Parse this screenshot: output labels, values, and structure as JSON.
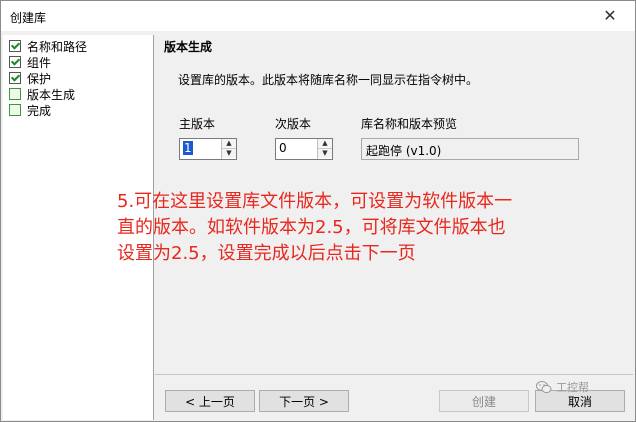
{
  "window": {
    "title": "创建库",
    "close_glyph": "✕"
  },
  "steps": [
    {
      "label": "名称和路径",
      "checked": true
    },
    {
      "label": "组件",
      "checked": true
    },
    {
      "label": "保护",
      "checked": true
    },
    {
      "label": "版本生成",
      "checked": false
    },
    {
      "label": "完成",
      "checked": false
    }
  ],
  "page": {
    "heading": "版本生成",
    "description": "设置库的版本。此版本将随库名称一同显示在指令树中。"
  },
  "version": {
    "major_label": "主版本",
    "major_value": "1",
    "minor_label": "次版本",
    "minor_value": "0",
    "preview_label": "库名称和版本预览",
    "preview_value": "起跑停 (v1.0)"
  },
  "annotation": {
    "line1": "5.可在这里设置库文件版本，可设置为软件版本一",
    "line2": "直的版本。如软件版本为2.5，可将库文件版本也",
    "line3": "设置为2.5，设置完成以后点击下一页"
  },
  "buttons": {
    "prev": "< 上一页",
    "next": "下一页 >",
    "create": "创建",
    "cancel": "取消"
  },
  "watermark": {
    "text": "工控帮",
    "icon": "wechat-icon"
  }
}
